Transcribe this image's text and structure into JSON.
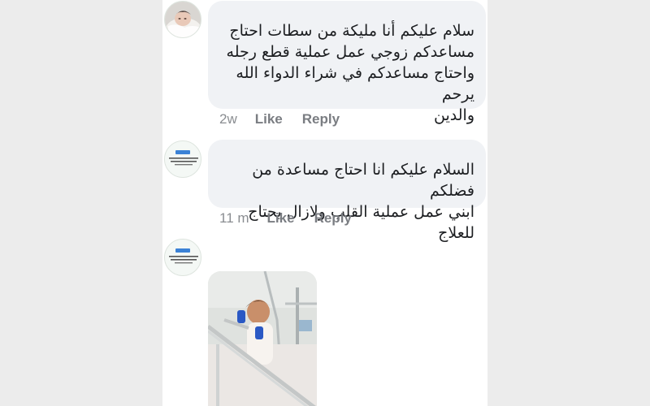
{
  "comments": [
    {
      "avatar_icon": "baby-photo-avatar",
      "text": "سلام عليكم أنا مليكة من سطات احتاج\nمساعدكم زوجي عمل عملية قطع رجله\nواحتاج مساعدكم في شراء الدواء الله يرحم\nوالدين",
      "time": "2w",
      "like_label": "Like",
      "reply_label": "Reply"
    },
    {
      "avatar_icon": "text-card-avatar",
      "text": "السلام عليكم انا احتاج مساعدة من فضلكم\nابني عمل عملية القلب ولازال يحتاج للعلاج",
      "time": "11 m",
      "like_label": "Like",
      "reply_label": "Reply"
    },
    {
      "avatar_icon": "text-card-avatar",
      "attachment_icon": "hospital-child-photo"
    }
  ]
}
